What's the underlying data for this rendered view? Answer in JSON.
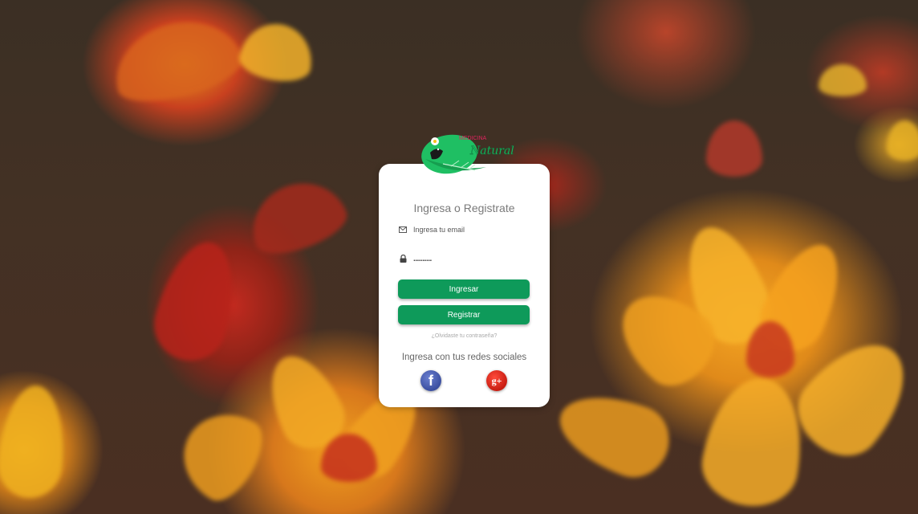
{
  "brand": {
    "logo_top": "MEDICINA",
    "logo_bottom": "Natural"
  },
  "login": {
    "title": "Ingresa o Registrate",
    "email_placeholder": "Ingresa tu email",
    "password_value": "..........",
    "login_button": "Ingresar",
    "register_button": "Registrar",
    "forgot_link": "¿Olvidaste tu contraseña?",
    "social_title": "Ingresa con tus redes sociales",
    "facebook_glyph": "f",
    "google_glyph": "g+"
  },
  "colors": {
    "accent_green": "#0e9a5a",
    "facebook_blue": "#3b4fa0",
    "google_red": "#c81d12",
    "logo_pink": "#e0245e"
  },
  "icons": [
    "envelope-icon",
    "lock-icon",
    "facebook-icon",
    "google-plus-icon"
  ]
}
